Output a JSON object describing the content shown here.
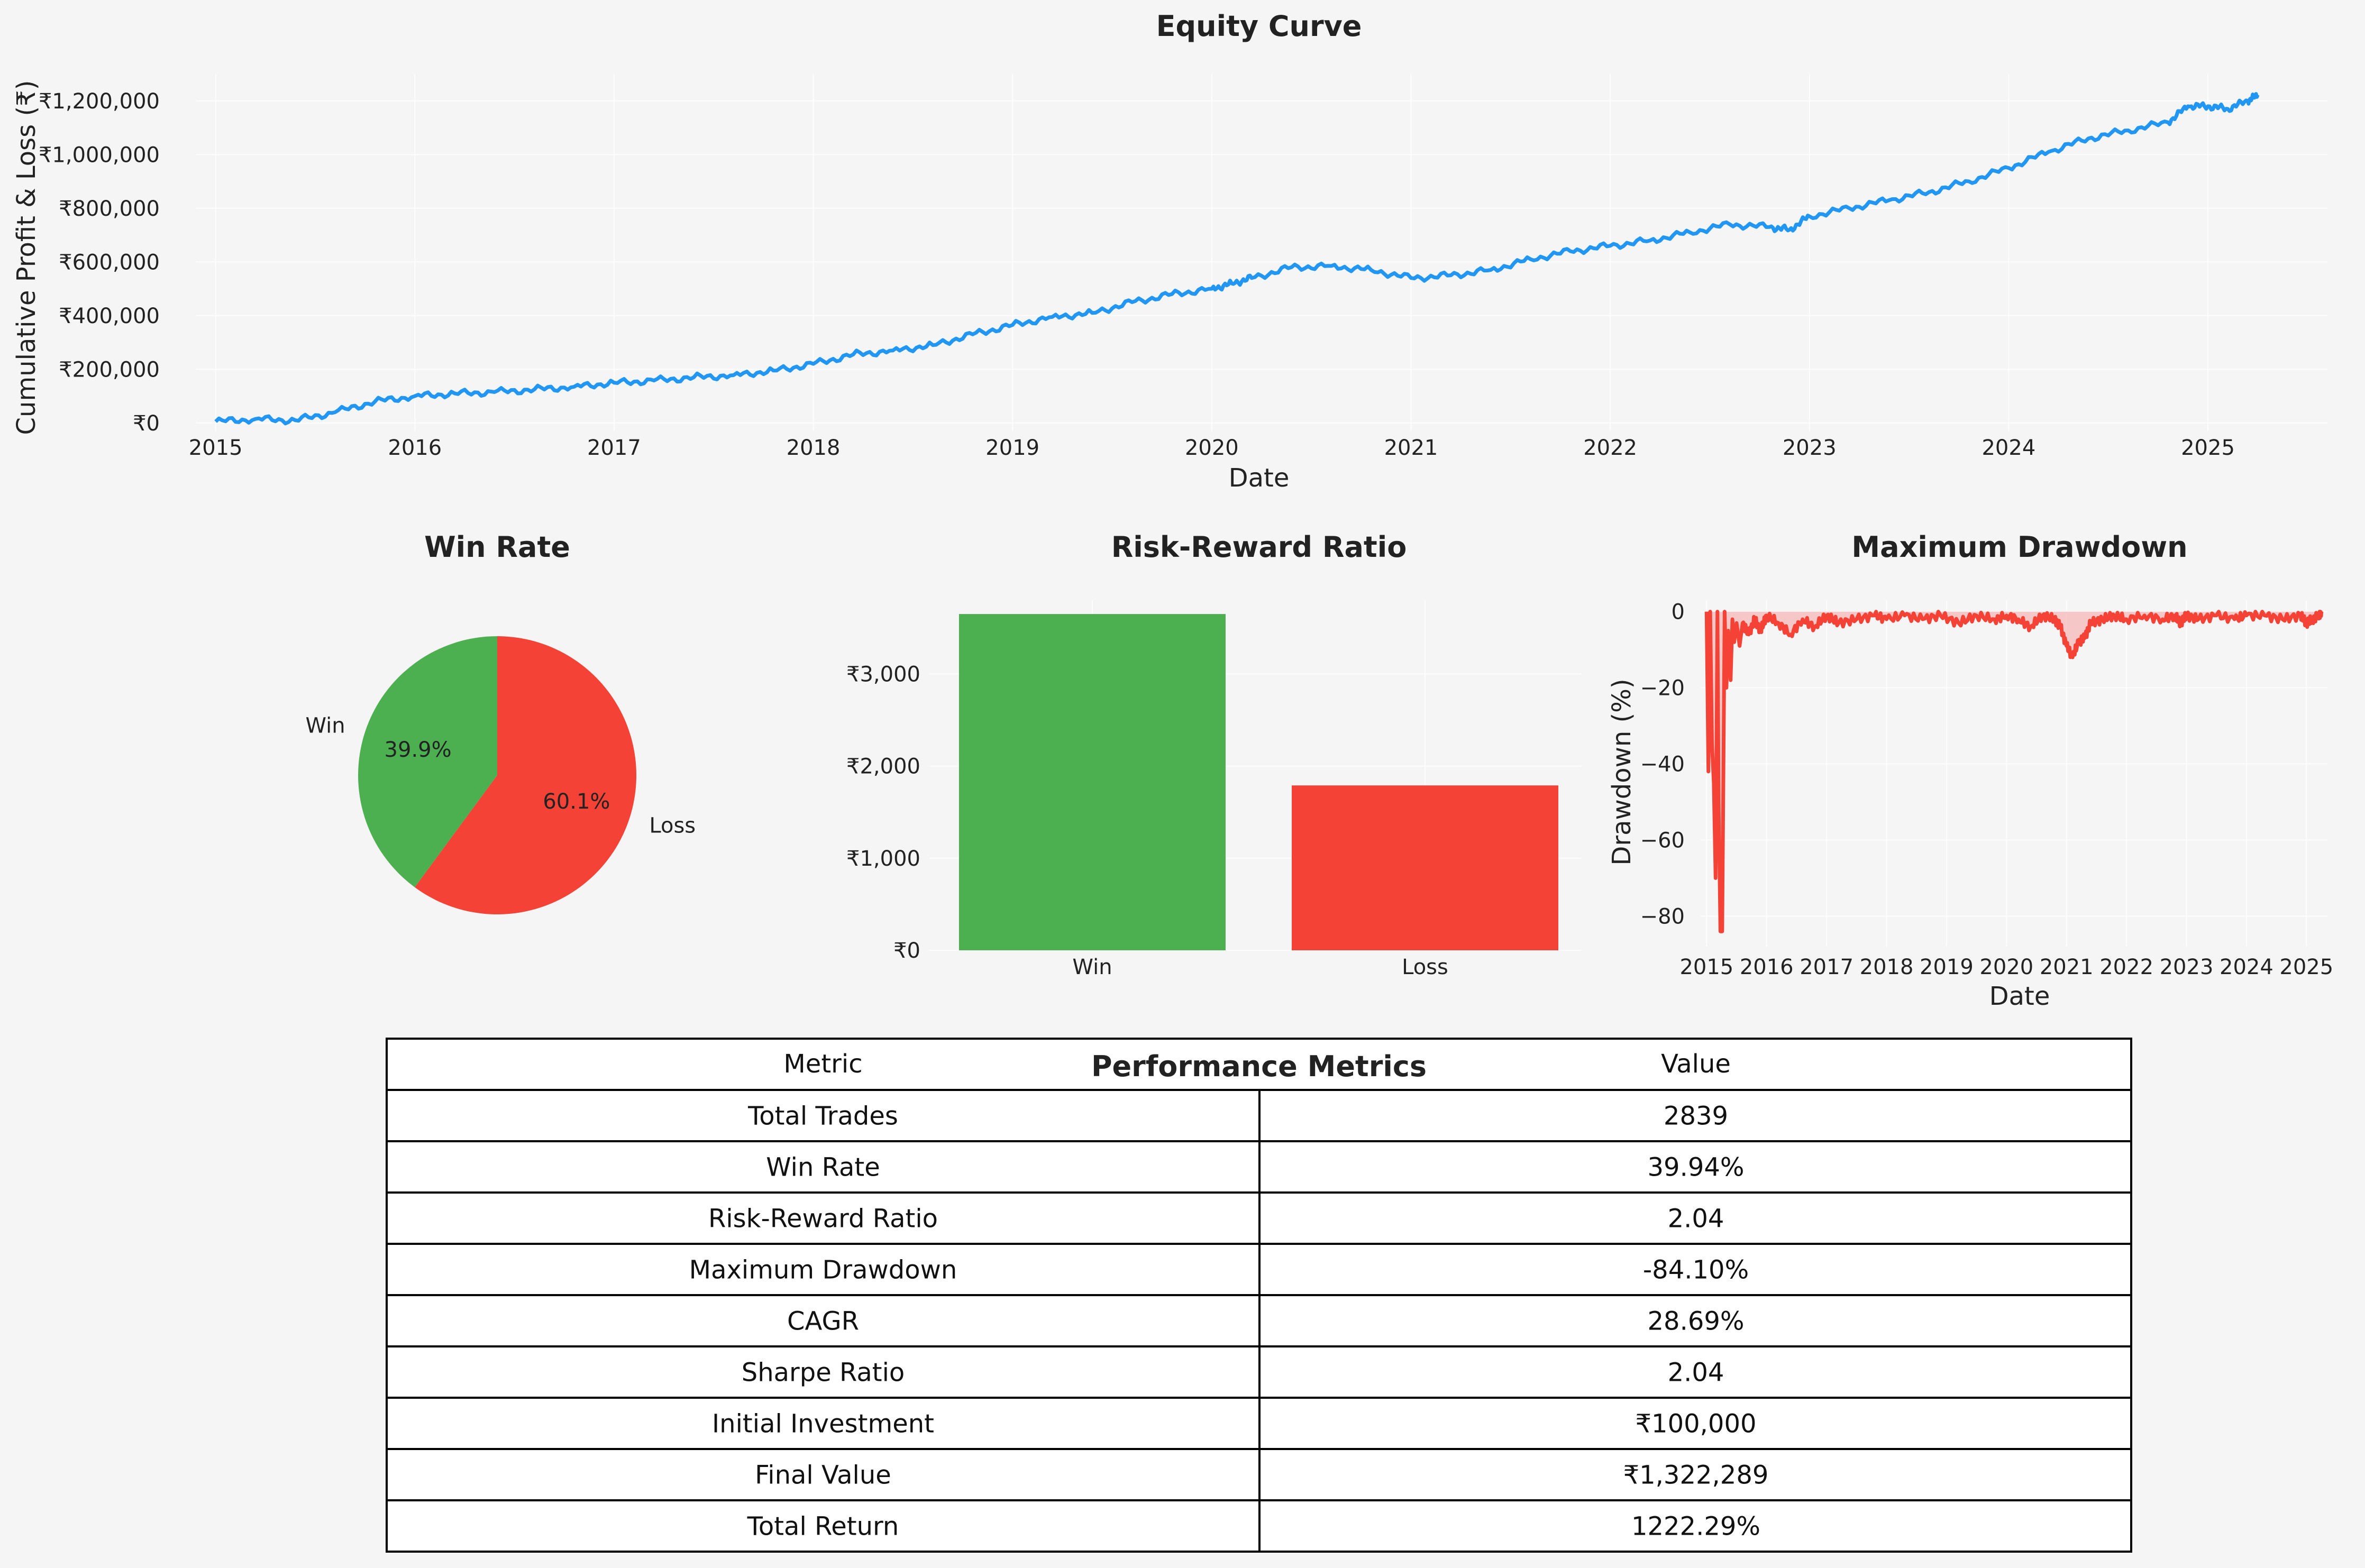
{
  "colors": {
    "background": "#f5f5f5",
    "equity_line": "#2196f3",
    "win": "#4caf50",
    "loss": "#f44336",
    "drawdown_line": "#f44336",
    "drawdown_fill": "#f6bcbc"
  },
  "chart_data": [
    {
      "type": "line",
      "title": "Equity Curve",
      "xlabel": "Date",
      "ylabel": "Cumulative Profit & Loss (₹)",
      "xlim": [
        2014.9,
        2025.6
      ],
      "ylim": [
        -30000,
        1300000
      ],
      "x_ticks": [
        "2015",
        "2016",
        "2017",
        "2018",
        "2019",
        "2020",
        "2021",
        "2022",
        "2023",
        "2024",
        "2025"
      ],
      "y_ticks": [
        {
          "v": 0,
          "label": "₹0"
        },
        {
          "v": 200000,
          "label": "₹200,000"
        },
        {
          "v": 400000,
          "label": "₹400,000"
        },
        {
          "v": 600000,
          "label": "₹600,000"
        },
        {
          "v": 800000,
          "label": "₹800,000"
        },
        {
          "v": 1000000,
          "label": "₹1,000,000"
        },
        {
          "v": 1200000,
          "label": "₹1,200,000"
        }
      ],
      "grid": true,
      "series": [
        {
          "x": [
            2015.0,
            2015.2,
            2015.4,
            2015.6,
            2015.8,
            2016.0,
            2016.2,
            2016.4,
            2016.6,
            2016.8,
            2017.0,
            2017.2,
            2017.4,
            2017.6,
            2017.8,
            2018.0,
            2018.2,
            2018.4,
            2018.6,
            2018.8,
            2019.0,
            2019.2,
            2019.4,
            2019.6,
            2019.8,
            2020.0,
            2020.1,
            2020.2,
            2020.4,
            2020.6,
            2020.8,
            2021.0,
            2021.2,
            2021.4,
            2021.6,
            2021.8,
            2022.0,
            2022.2,
            2022.4,
            2022.6,
            2022.8,
            2022.9,
            2023.0,
            2023.2,
            2023.4,
            2023.6,
            2023.8,
            2024.0,
            2024.2,
            2024.4,
            2024.6,
            2024.8,
            2024.9,
            2025.0,
            2025.1,
            2025.2,
            2025.25
          ],
          "values": [
            5000,
            15000,
            10000,
            40000,
            80000,
            100000,
            110000,
            115000,
            125000,
            135000,
            150000,
            158000,
            170000,
            178000,
            195000,
            220000,
            255000,
            270000,
            290000,
            330000,
            365000,
            395000,
            410000,
            450000,
            480000,
            500000,
            520000,
            540000,
            580000,
            585000,
            570000,
            540000,
            550000,
            570000,
            610000,
            640000,
            660000,
            680000,
            710000,
            740000,
            730000,
            720000,
            770000,
            800000,
            830000,
            860000,
            900000,
            950000,
            1010000,
            1060000,
            1090000,
            1120000,
            1180000,
            1180000,
            1170000,
            1200000,
            1222289
          ]
        }
      ]
    },
    {
      "type": "pie",
      "title": "Win Rate",
      "labels": [
        "Win",
        "Loss"
      ],
      "values": [
        39.9,
        60.1
      ],
      "pct_labels": [
        "39.9%",
        "60.1%"
      ]
    },
    {
      "type": "bar",
      "title": "Risk-Reward Ratio",
      "categories": [
        "Win",
        "Loss"
      ],
      "values": [
        3650,
        1790
      ],
      "ylim": [
        0,
        3800
      ],
      "y_ticks": [
        {
          "v": 0,
          "label": "₹0"
        },
        {
          "v": 1000,
          "label": "₹1,000"
        },
        {
          "v": 2000,
          "label": "₹2,000"
        },
        {
          "v": 3000,
          "label": "₹3,000"
        }
      ],
      "grid": true
    },
    {
      "type": "area",
      "title": "Maximum Drawdown",
      "xlabel": "Date",
      "ylabel": "Drawdown (%)",
      "xlim": [
        2014.9,
        2025.35
      ],
      "ylim": [
        -88,
        3
      ],
      "x_ticks": [
        "2015",
        "2016",
        "2017",
        "2018",
        "2019",
        "2020",
        "2021",
        "2022",
        "2023",
        "2024",
        "2025"
      ],
      "y_ticks": [
        {
          "v": 0,
          "label": "0"
        },
        {
          "v": -20,
          "label": "−20"
        },
        {
          "v": -40,
          "label": "−40"
        },
        {
          "v": -60,
          "label": "−60"
        },
        {
          "v": -80,
          "label": "−80"
        }
      ],
      "grid": true,
      "series": [
        {
          "x": [
            2015.0,
            2015.03,
            2015.06,
            2015.09,
            2015.12,
            2015.15,
            2015.18,
            2015.2,
            2015.23,
            2015.26,
            2015.3,
            2015.33,
            2015.36,
            2015.4,
            2015.43,
            2015.46,
            2015.5,
            2015.55,
            2015.6,
            2015.7,
            2015.8,
            2015.9,
            2016.0,
            2016.2,
            2016.4,
            2016.6,
            2016.8,
            2017.0,
            2017.2,
            2017.5,
            2017.8,
            2018.0,
            2018.3,
            2018.6,
            2018.9,
            2019.2,
            2019.5,
            2019.8,
            2020.0,
            2020.2,
            2020.4,
            2020.6,
            2020.8,
            2020.9,
            2021.0,
            2021.1,
            2021.2,
            2021.3,
            2021.4,
            2021.6,
            2021.8,
            2022.0,
            2022.3,
            2022.6,
            2022.8,
            2022.9,
            2023.0,
            2023.2,
            2023.5,
            2023.8,
            2024.0,
            2024.3,
            2024.6,
            2024.9,
            2025.0,
            2025.1,
            2025.2,
            2025.25
          ],
          "values": [
            0,
            -42,
            0,
            -35,
            -45,
            -70,
            0,
            -50,
            -84,
            -84,
            0,
            -20,
            -5,
            -18,
            -2,
            -8,
            -3,
            -9,
            -3,
            -6,
            -2,
            -5,
            -1,
            -3,
            -6,
            -2,
            -4,
            -1,
            -3,
            -2,
            -1,
            -2,
            -1,
            -2,
            -1,
            -3,
            -1,
            -2,
            -1,
            -2,
            -4,
            -1,
            -2,
            -4,
            -9,
            -12,
            -8,
            -7,
            -3,
            -2,
            -1,
            -2,
            -1,
            -2,
            -1,
            -3,
            -1,
            -2,
            -1,
            -2,
            -1,
            -1,
            -2,
            -1,
            -3,
            -2,
            -1,
            0
          ]
        }
      ]
    }
  ],
  "table": {
    "title": "Performance Metrics",
    "headers": [
      "Metric",
      "Value"
    ],
    "rows": [
      [
        "Total Trades",
        "2839"
      ],
      [
        "Win Rate",
        "39.94%"
      ],
      [
        "Risk-Reward Ratio",
        "2.04"
      ],
      [
        "Maximum Drawdown",
        "-84.10%"
      ],
      [
        "CAGR",
        "28.69%"
      ],
      [
        "Sharpe Ratio",
        "2.04"
      ],
      [
        "Initial Investment",
        "₹100,000"
      ],
      [
        "Final Value",
        "₹1,322,289"
      ],
      [
        "Total Return",
        "1222.29%"
      ]
    ]
  }
}
